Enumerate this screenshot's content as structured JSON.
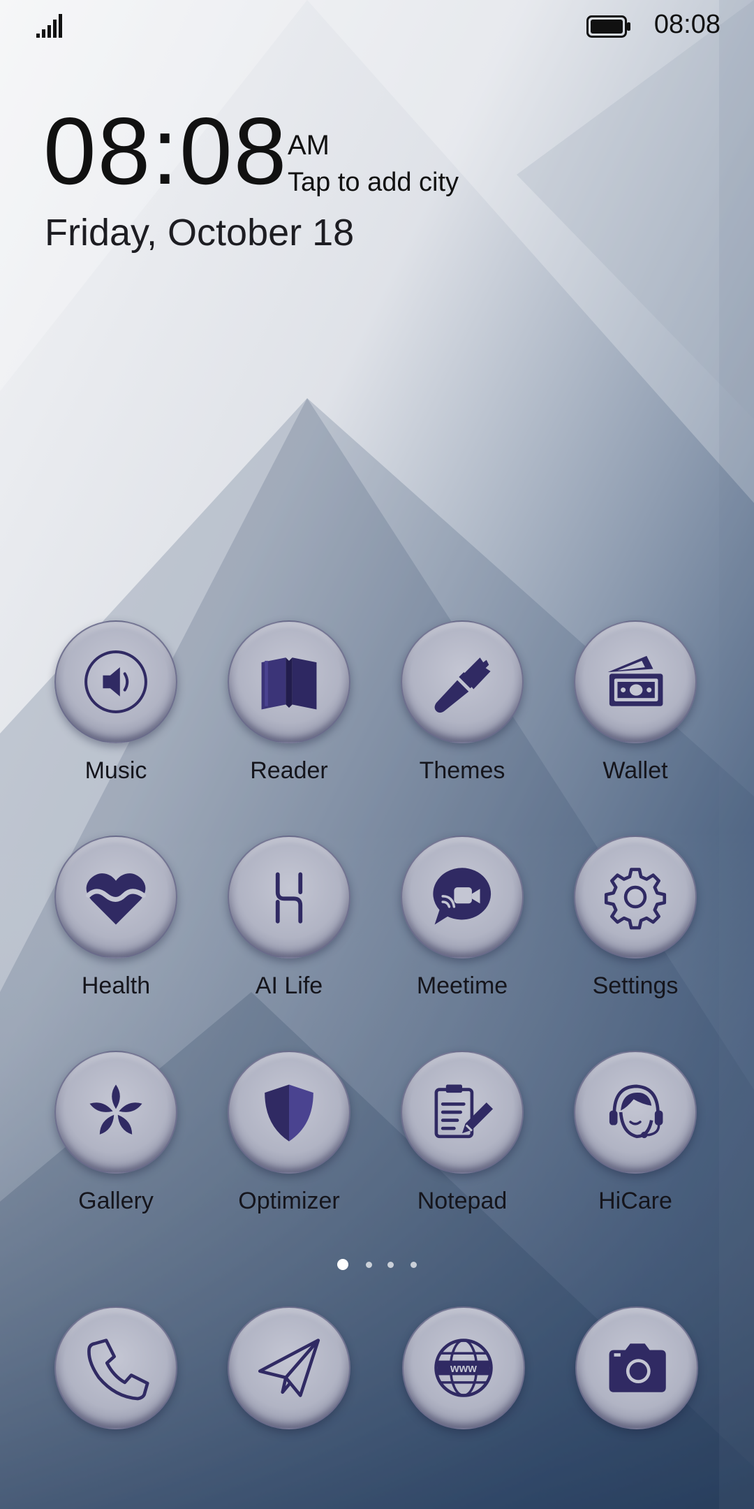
{
  "status_bar": {
    "signal_icon": "signal-icon",
    "battery_icon": "battery-icon",
    "time": "08:08"
  },
  "clock_widget": {
    "time": "08:08",
    "ampm": "AM",
    "city_prompt": "Tap to add city",
    "date": "Friday, October 18"
  },
  "apps": [
    {
      "label": "Music",
      "icon": "speaker-icon"
    },
    {
      "label": "Reader",
      "icon": "book-icon"
    },
    {
      "label": "Themes",
      "icon": "brush-icon"
    },
    {
      "label": "Wallet",
      "icon": "money-icon"
    },
    {
      "label": "Health",
      "icon": "heart-icon"
    },
    {
      "label": "AI Life",
      "icon": "ai-life-icon"
    },
    {
      "label": "Meetime",
      "icon": "video-chat-icon"
    },
    {
      "label": "Settings",
      "icon": "gear-icon"
    },
    {
      "label": "Gallery",
      "icon": "flower-icon"
    },
    {
      "label": "Optimizer",
      "icon": "shield-icon"
    },
    {
      "label": "Notepad",
      "icon": "notepad-icon"
    },
    {
      "label": "HiCare",
      "icon": "headset-icon"
    }
  ],
  "page_indicator": {
    "pages": 4,
    "current": 1
  },
  "dock": [
    {
      "name": "phone",
      "icon": "phone-icon"
    },
    {
      "name": "messages",
      "icon": "paper-plane-icon"
    },
    {
      "name": "browser",
      "icon": "globe-icon",
      "icon_text": "www"
    },
    {
      "name": "camera",
      "icon": "camera-icon"
    }
  ],
  "colors": {
    "icon_glyph": "#302a63",
    "label_text": "#15151c",
    "wallpaper_top": "#eef0f3",
    "wallpaper_bottom": "#243a5a"
  }
}
